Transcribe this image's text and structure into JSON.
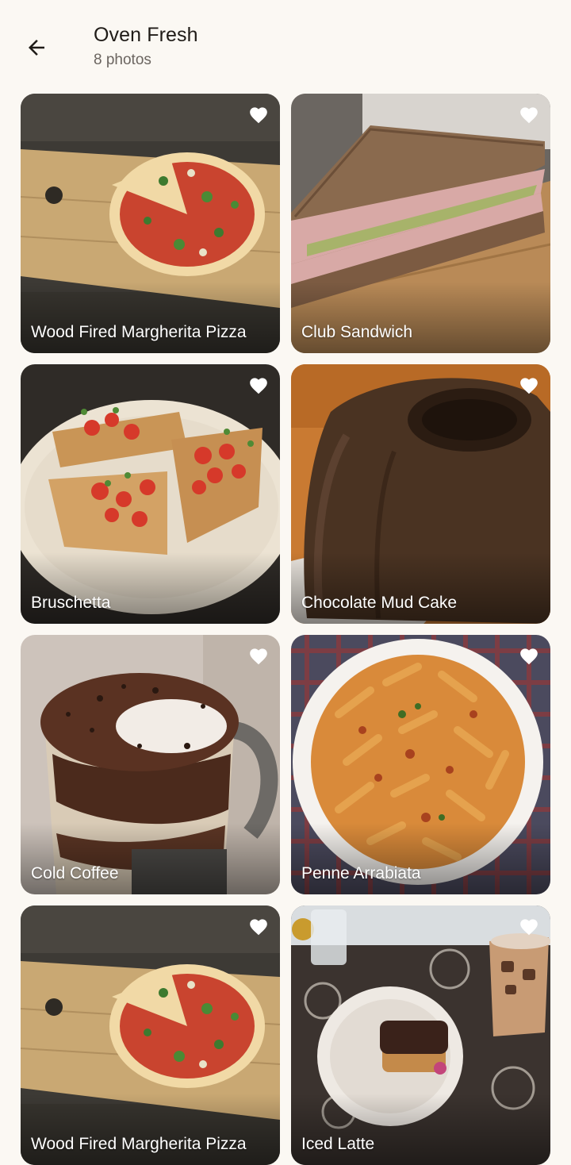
{
  "header": {
    "title": "Oven Fresh",
    "subtitle": "8 photos",
    "back_icon": "arrow-left-icon"
  },
  "photos": [
    {
      "label": "Wood Fired Margherita Pizza",
      "favorite_icon": "heart-icon"
    },
    {
      "label": "Club Sandwich",
      "favorite_icon": "heart-icon"
    },
    {
      "label": "Bruschetta",
      "favorite_icon": "heart-icon"
    },
    {
      "label": "Chocolate Mud Cake",
      "favorite_icon": "heart-icon"
    },
    {
      "label": "Cold Coffee",
      "favorite_icon": "heart-icon"
    },
    {
      "label": "Penne Arrabiata",
      "favorite_icon": "heart-icon"
    },
    {
      "label": "Wood Fired Margherita Pizza",
      "favorite_icon": "heart-icon"
    },
    {
      "label": "Iced Latte",
      "favorite_icon": "heart-icon"
    }
  ],
  "colors": {
    "background": "#fbf8f3",
    "text_primary": "#1f1b17",
    "text_secondary": "#6b6560",
    "overlay_text": "#ffffff"
  }
}
